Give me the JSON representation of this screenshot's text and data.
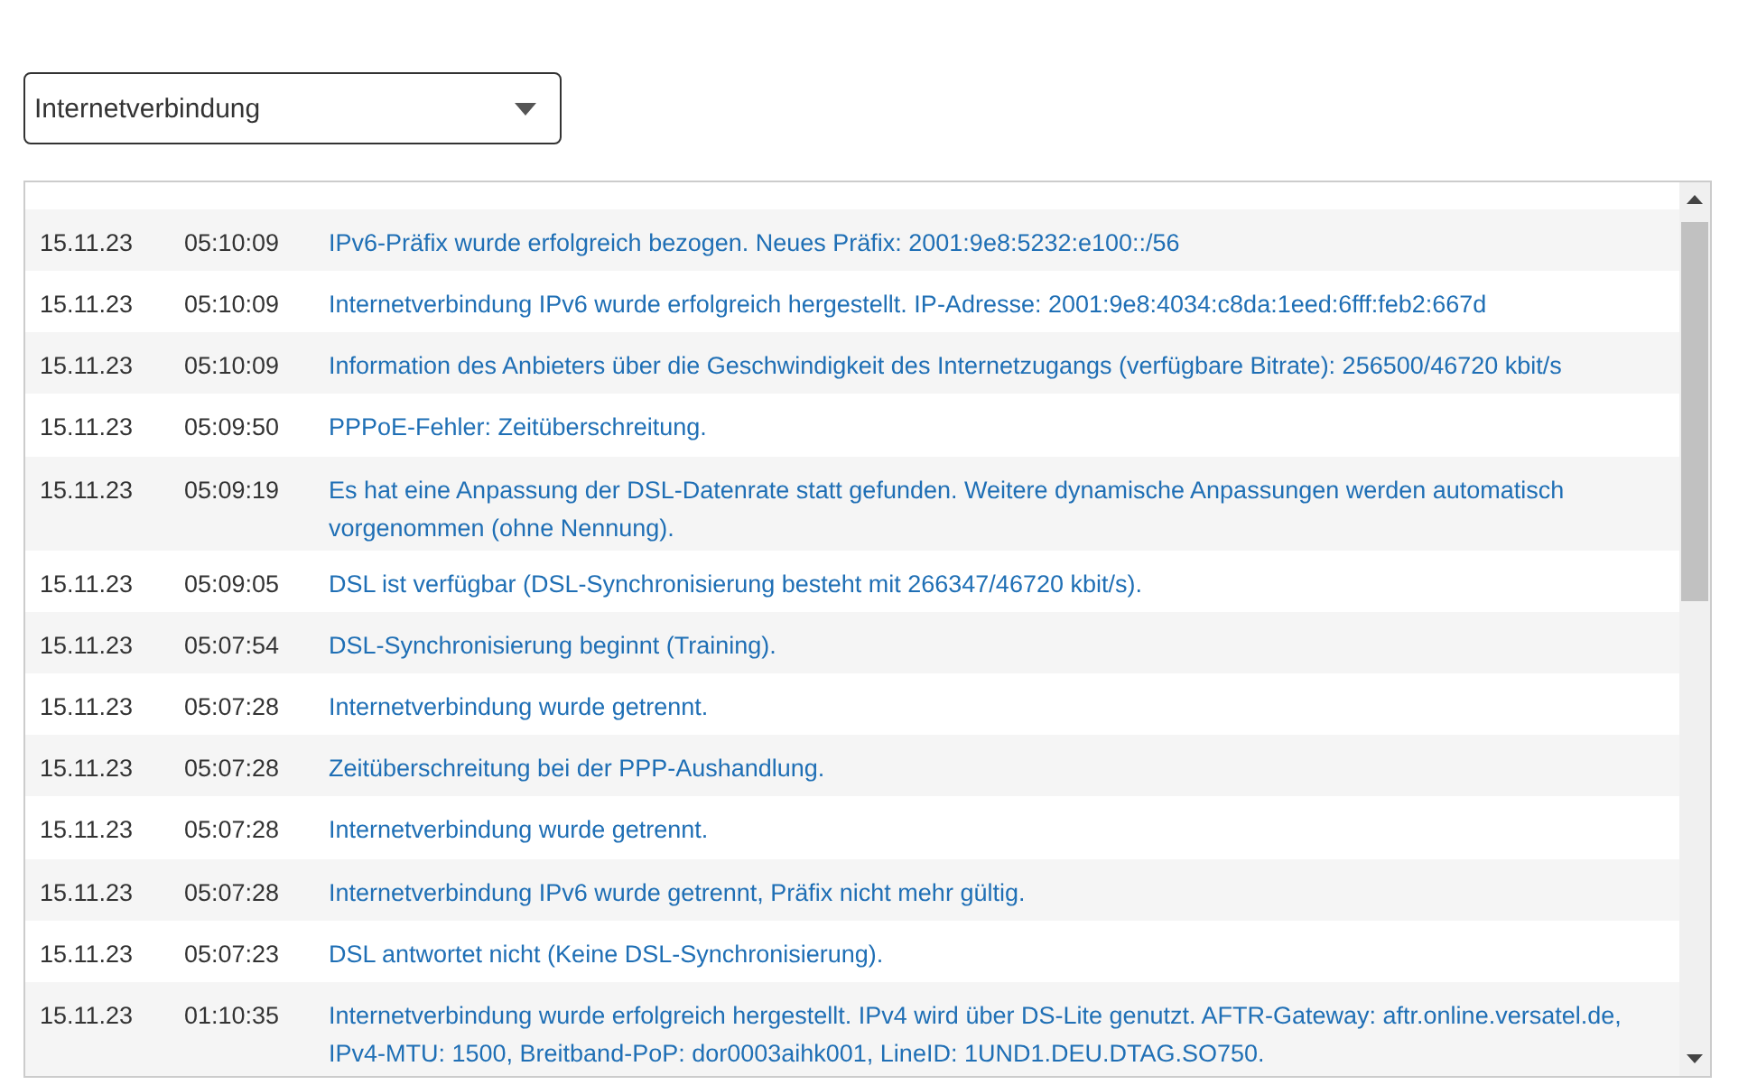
{
  "filter_dropdown": {
    "value": "Internetverbindung"
  },
  "log": {
    "rows": [
      {
        "kind": "full",
        "date": "15.11.23",
        "time": "05:10:09",
        "message": "IPv6-Präfix wurde erfolgreich bezogen. Neues Präfix: 2001:9e8:5232:e100::/56"
      },
      {
        "kind": "full",
        "date": "15.11.23",
        "time": "05:10:09",
        "message": "Internetverbindung IPv6 wurde erfolgreich hergestellt. IP-Adresse: 2001:9e8:4034:c8da:1eed:6fff:feb2:667d"
      },
      {
        "kind": "full",
        "date": "15.11.23",
        "time": "05:10:09",
        "message": "Information des Anbieters über die Geschwindigkeit des Internetzugangs (verfügbare Bitrate): 256500/46720 kbit/s"
      },
      {
        "kind": "full",
        "date": "15.11.23",
        "time": "05:09:50",
        "message": "PPPoE-Fehler: Zeitüberschreitung."
      },
      {
        "kind": "full",
        "date": "15.11.23",
        "time": "05:09:19",
        "message": "Es hat eine Anpassung der DSL-Datenrate statt gefunden. Weitere dynamische Anpassungen werden automatisch vorgenommen (ohne Nennung)."
      },
      {
        "kind": "full",
        "date": "15.11.23",
        "time": "05:09:05",
        "message": "DSL ist verfügbar (DSL-Synchronisierung besteht mit 266347/46720 kbit/s)."
      },
      {
        "kind": "full",
        "date": "15.11.23",
        "time": "05:07:54",
        "message": "DSL-Synchronisierung beginnt (Training)."
      },
      {
        "kind": "full",
        "date": "15.11.23",
        "time": "05:07:28",
        "message": "Internetverbindung wurde getrennt."
      },
      {
        "kind": "full",
        "date": "15.11.23",
        "time": "05:07:28",
        "message": "Zeitüberschreitung bei der PPP-Aushandlung."
      },
      {
        "kind": "full",
        "date": "15.11.23",
        "time": "05:07:28",
        "message": "Internetverbindung wurde getrennt."
      },
      {
        "kind": "full",
        "date": "15.11.23",
        "time": "05:07:28",
        "message": "Internetverbindung IPv6 wurde getrennt, Präfix nicht mehr gültig."
      },
      {
        "kind": "full",
        "date": "15.11.23",
        "time": "05:07:23",
        "message": "DSL antwortet nicht (Keine DSL-Synchronisierung)."
      },
      {
        "kind": "full",
        "date": "15.11.23",
        "time": "01:10:35",
        "message": "Internetverbindung wurde erfolgreich hergestellt. IPv4 wird über DS-Lite genutzt. AFTR-Gateway: aftr.online.versatel.de, IPv4-MTU: 1500, Breitband-PoP: dor0003aihk001, LineID: 1UND1.DEU.DTAG.SO750."
      }
    ]
  }
}
